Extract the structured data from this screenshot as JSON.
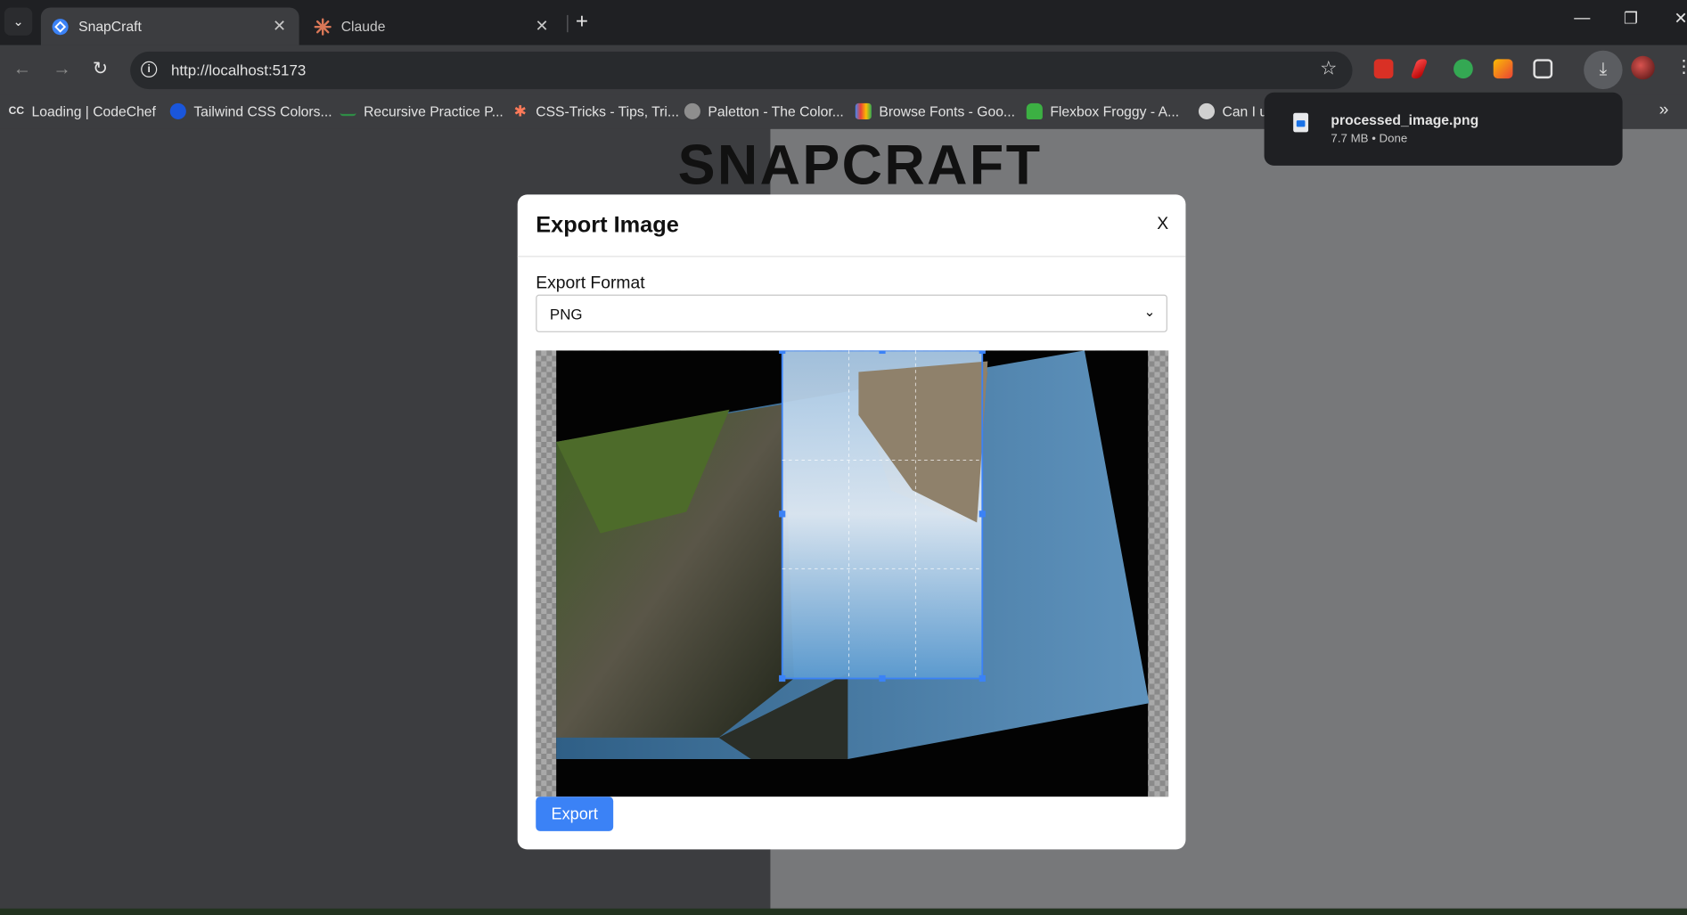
{
  "browser": {
    "tabs": [
      {
        "title": "SnapCraft",
        "active": true
      },
      {
        "title": "Claude",
        "active": false
      }
    ],
    "url": "http://localhost:5173",
    "bookmarks": [
      "Loading | CodeChef",
      "Tailwind CSS Colors...",
      "Recursive Practice P...",
      "CSS-Tricks - Tips, Tri...",
      "Paletton - The Color...",
      "Browse Fonts - Goo...",
      "Flexbox Froggy - A...",
      "Can I u"
    ],
    "bookmark_badge_cc": "CC"
  },
  "download": {
    "filename": "processed_image.png",
    "meta": "7.7 MB • Done"
  },
  "page": {
    "logo": "SNAPCRAFT"
  },
  "modal": {
    "title": "Export Image",
    "close_label": "X",
    "format_label": "Export Format",
    "format_value": "PNG",
    "export_button": "Export"
  },
  "colors": {
    "accent": "#3b82f6",
    "chrome_dark": "#1f2023",
    "chrome_mid": "#3c3d40"
  }
}
